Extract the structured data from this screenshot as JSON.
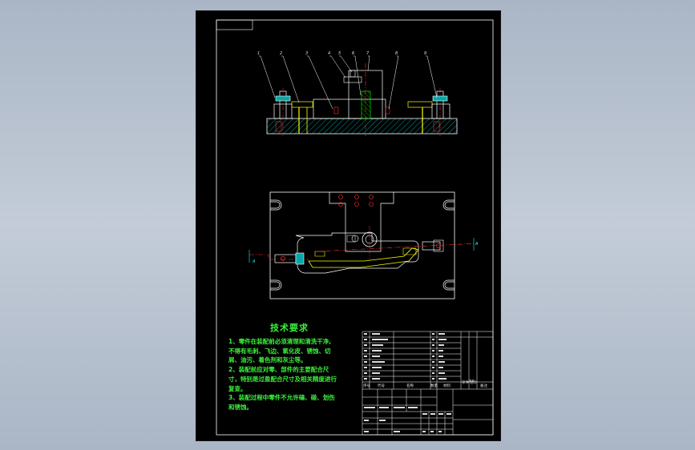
{
  "tech_requirements": {
    "title": "技术要求",
    "lines": [
      "1、零件在装配前必须清理和清洗干净,",
      "不得有毛刺、飞边、氧化皮、锈蚀、切",
      "屑、油污、着色剂和灰尘等。",
      "2、装配前应对零、部件的主要配合尺",
      "寸，特别是过盈配合尺寸及相关精度进行",
      "复查。",
      "3、装配过程中零件不允许磕、碰、划伤",
      "和锈蚀。"
    ]
  },
  "balloons": [
    "1",
    "2",
    "3",
    "4",
    "5",
    "6",
    "7",
    "8",
    "9"
  ],
  "section_marks": {
    "left": "A",
    "right": "A"
  },
  "title_block": {
    "header_cells": [
      "序号",
      "代号",
      "名称",
      "数量",
      "材料",
      "单件 总计",
      "备注"
    ],
    "weight_label": "重量"
  },
  "colors": {
    "sheet_bg": "#000000",
    "line_white": "#ffffff",
    "line_yellow": "#ffff00",
    "line_cyan": "#00ffff",
    "line_red": "#ff3030",
    "line_green": "#00ff00",
    "line_magenta": "#ff44ff",
    "text_green": "#3cf03c"
  }
}
